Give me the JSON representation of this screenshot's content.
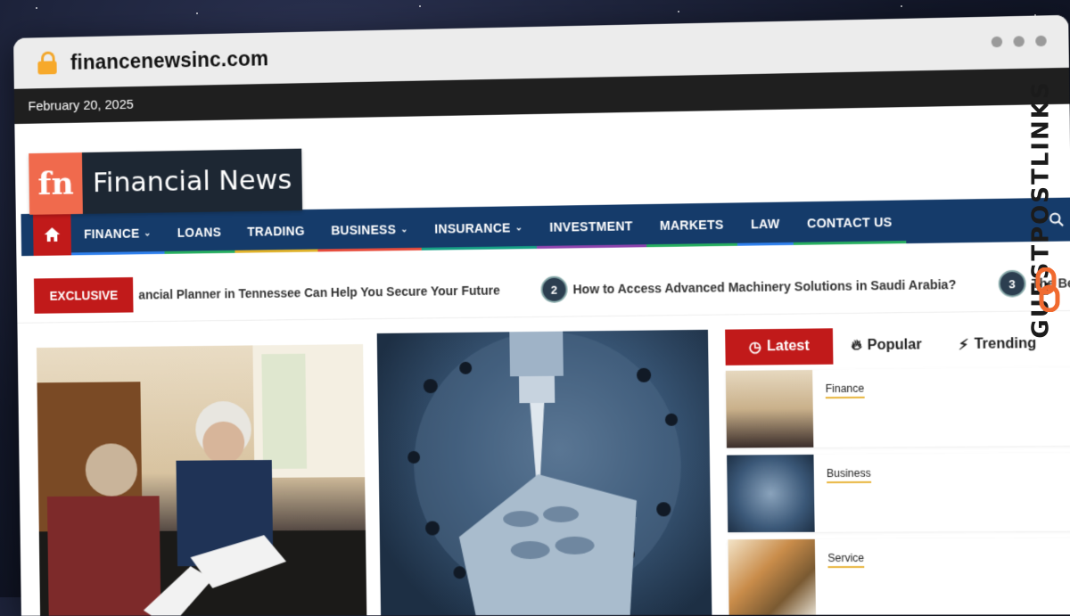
{
  "browser": {
    "url": "financenewsinc.com"
  },
  "site": {
    "date": "February 20, 2025",
    "logo": {
      "mark": "fn",
      "name": "Financial News"
    },
    "nav": [
      {
        "label": "FINANCE",
        "dropdown": true,
        "underline": "#2f80ed"
      },
      {
        "label": "LOANS",
        "dropdown": false,
        "underline": "#27ae60"
      },
      {
        "label": "TRADING",
        "dropdown": false,
        "underline": "#e0b22a"
      },
      {
        "label": "BUSINESS",
        "dropdown": true,
        "underline": "#e74c3c"
      },
      {
        "label": "INSURANCE",
        "dropdown": true,
        "underline": "#16a085"
      },
      {
        "label": "INVESTMENT",
        "dropdown": false,
        "underline": "#8e44ad"
      },
      {
        "label": "MARKETS",
        "dropdown": false,
        "underline": "#27ae60"
      },
      {
        "label": "LAW",
        "dropdown": false,
        "underline": "#2f80ed"
      },
      {
        "label": "CONTACT US",
        "dropdown": false,
        "underline": "#27ae60"
      }
    ],
    "ticker": {
      "badge": "EXCLUSIVE",
      "items": [
        {
          "num": "",
          "text": "ancial Planner in Tennessee Can Help You Secure Your Future"
        },
        {
          "num": "2",
          "text": "How to Access Advanced Machinery Solutions in Saudi Arabia?"
        },
        {
          "num": "3",
          "text": "The Benefits of Full-Service"
        }
      ]
    },
    "tabs": [
      {
        "label": "Latest",
        "icon": "clock-icon"
      },
      {
        "label": "Popular",
        "icon": "flame-icon"
      },
      {
        "label": "Trending",
        "icon": "bolt-icon"
      }
    ],
    "side_items": [
      {
        "category": "Finance"
      },
      {
        "category": "Business"
      },
      {
        "category": "Service"
      }
    ]
  },
  "watermark": {
    "text": "GUESTPOSTLINKS"
  },
  "colors": {
    "accent": "#c11a1a",
    "nav_bg": "#153b6a",
    "topbar": "#1f1f1f"
  }
}
